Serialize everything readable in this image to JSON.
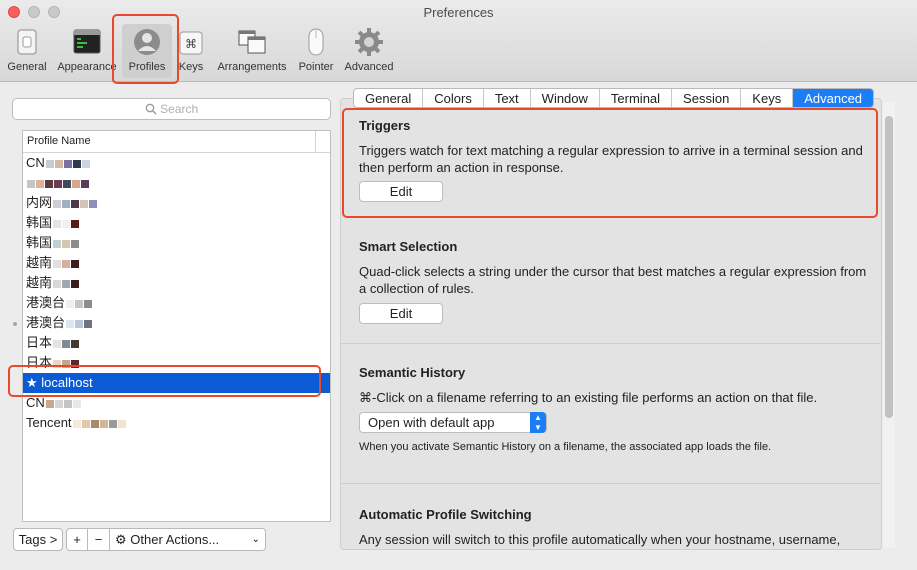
{
  "window": {
    "title": "Preferences"
  },
  "toolbar": {
    "items": [
      {
        "label": "General",
        "icon": "general-switch-icon"
      },
      {
        "label": "Appearance",
        "icon": "terminal-window-icon"
      },
      {
        "label": "Profiles",
        "icon": "profile-person-icon",
        "active": true
      },
      {
        "label": "Keys",
        "icon": "command-key-icon"
      },
      {
        "label": "Arrangements",
        "icon": "window-arrangements-icon"
      },
      {
        "label": "Pointer",
        "icon": "mouse-icon"
      },
      {
        "label": "Advanced",
        "icon": "gear-icon"
      }
    ]
  },
  "search": {
    "placeholder": "Search"
  },
  "profiles": {
    "header": "Profile Name",
    "rows": [
      {
        "text": "CN",
        "blur": [
          "#c5ccd3",
          "#d4b8a3",
          "#7b6fa0",
          "#2f3a4c",
          "#cfd3e0"
        ]
      },
      {
        "text": "",
        "blur": [
          "#c5c5c5",
          "#d9b39a",
          "#5a3c3c",
          "#6e3c51",
          "#3f4c5a",
          "#d6a78b",
          "#5b3b56"
        ]
      },
      {
        "text": "内网",
        "blur": [
          "#cfcfcf",
          "#9fb1c4",
          "#4d3b48",
          "#d3c2b6",
          "#8b90b4"
        ]
      },
      {
        "text": "韩国",
        "blur": [
          "#e4e4e4",
          "#f0f0f0",
          "#5a1a1a"
        ]
      },
      {
        "text": "韩国",
        "blur": [
          "#c2d0cf",
          "#d8c7b0",
          "#8d8d8d"
        ]
      },
      {
        "text": "越南",
        "blur": [
          "#e0e0e0",
          "#d7b0a1",
          "#3b1d1d"
        ]
      },
      {
        "text": "越南",
        "blur": [
          "#d8d8d8",
          "#9ea8b2",
          "#3b1d1d"
        ]
      },
      {
        "text": "港澳台",
        "blur": [
          "#eef0f0",
          "#bfc6ca",
          "#8c8c8c"
        ]
      },
      {
        "text": "港澳台",
        "blur": [
          "#dbe6ee",
          "#b8c6d6",
          "#6b7480"
        ]
      },
      {
        "text": "日本",
        "blur": [
          "#e3e3e3",
          "#7c8c98",
          "#45392f"
        ]
      },
      {
        "text": "日本",
        "blur": [
          "#e8d8c6",
          "#c5a88c",
          "#5b2929"
        ]
      },
      {
        "text": "★ localhost",
        "selected": true
      },
      {
        "text": "CN",
        "blur": [
          "#c9a78e",
          "#d5d5d5",
          "#c4c4c4",
          "#e8e8e8"
        ]
      },
      {
        "text": "Tencent",
        "blur": [
          "#f3e9dc",
          "#e0c9ac",
          "#a88a67",
          "#d0b69b",
          "#9a9a9a",
          "#f2e3cf"
        ]
      }
    ]
  },
  "bottom_bar": {
    "tags_label": "Tags >",
    "add_label": "+",
    "remove_label": "−",
    "other_actions_label": "Other Actions...",
    "gear_icon": "gear-icon",
    "chevron_icon": "chevron-down-icon"
  },
  "tabs": [
    "General",
    "Colors",
    "Text",
    "Window",
    "Terminal",
    "Session",
    "Keys",
    "Advanced"
  ],
  "active_tab": "Advanced",
  "sections": {
    "triggers": {
      "title": "Triggers",
      "text": "Triggers watch for text matching a regular expression to arrive in a terminal session and then perform an action in response.",
      "button": "Edit"
    },
    "smart_selection": {
      "title": "Smart Selection",
      "text": "Quad-click selects a string under the cursor that best matches a regular expression from a collection of rules.",
      "button": "Edit"
    },
    "semantic_history": {
      "title": "Semantic History",
      "text": "⌘-Click on a filename referring to an existing file performs an action on that file.",
      "popup_value": "Open with default app",
      "note": "When you activate Semantic History on a filename, the associated app loads the file."
    },
    "auto_switching": {
      "title": "Automatic Profile Switching",
      "text": "Any session will switch to this profile automatically when your hostname, username,"
    }
  },
  "colors": {
    "accent": "#1b7ef6",
    "selection": "#0b5bd7",
    "highlight": "#e8492b"
  }
}
